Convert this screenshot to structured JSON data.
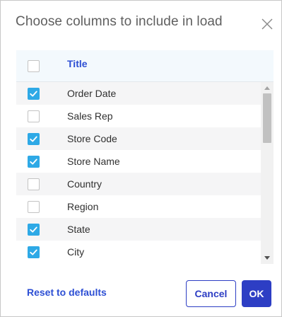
{
  "dialog": {
    "title": "Choose columns to include in load",
    "close_icon": "close-icon"
  },
  "table": {
    "header": {
      "title": "Title",
      "select_all_checked": false
    },
    "rows": [
      {
        "label": "Order Date",
        "checked": true
      },
      {
        "label": "Sales Rep",
        "checked": false
      },
      {
        "label": "Store Code",
        "checked": true
      },
      {
        "label": "Store Name",
        "checked": true
      },
      {
        "label": "Country",
        "checked": false
      },
      {
        "label": "Region",
        "checked": false
      },
      {
        "label": "State",
        "checked": true
      },
      {
        "label": "City",
        "checked": true
      }
    ]
  },
  "footer": {
    "reset_label": "Reset to defaults",
    "cancel_label": "Cancel",
    "ok_label": "OK"
  },
  "colors": {
    "accent": "#2d3ec4",
    "link": "#2d4fd4",
    "checkbox_checked": "#2ea9e6",
    "header_bg": "#f3f9fd"
  }
}
